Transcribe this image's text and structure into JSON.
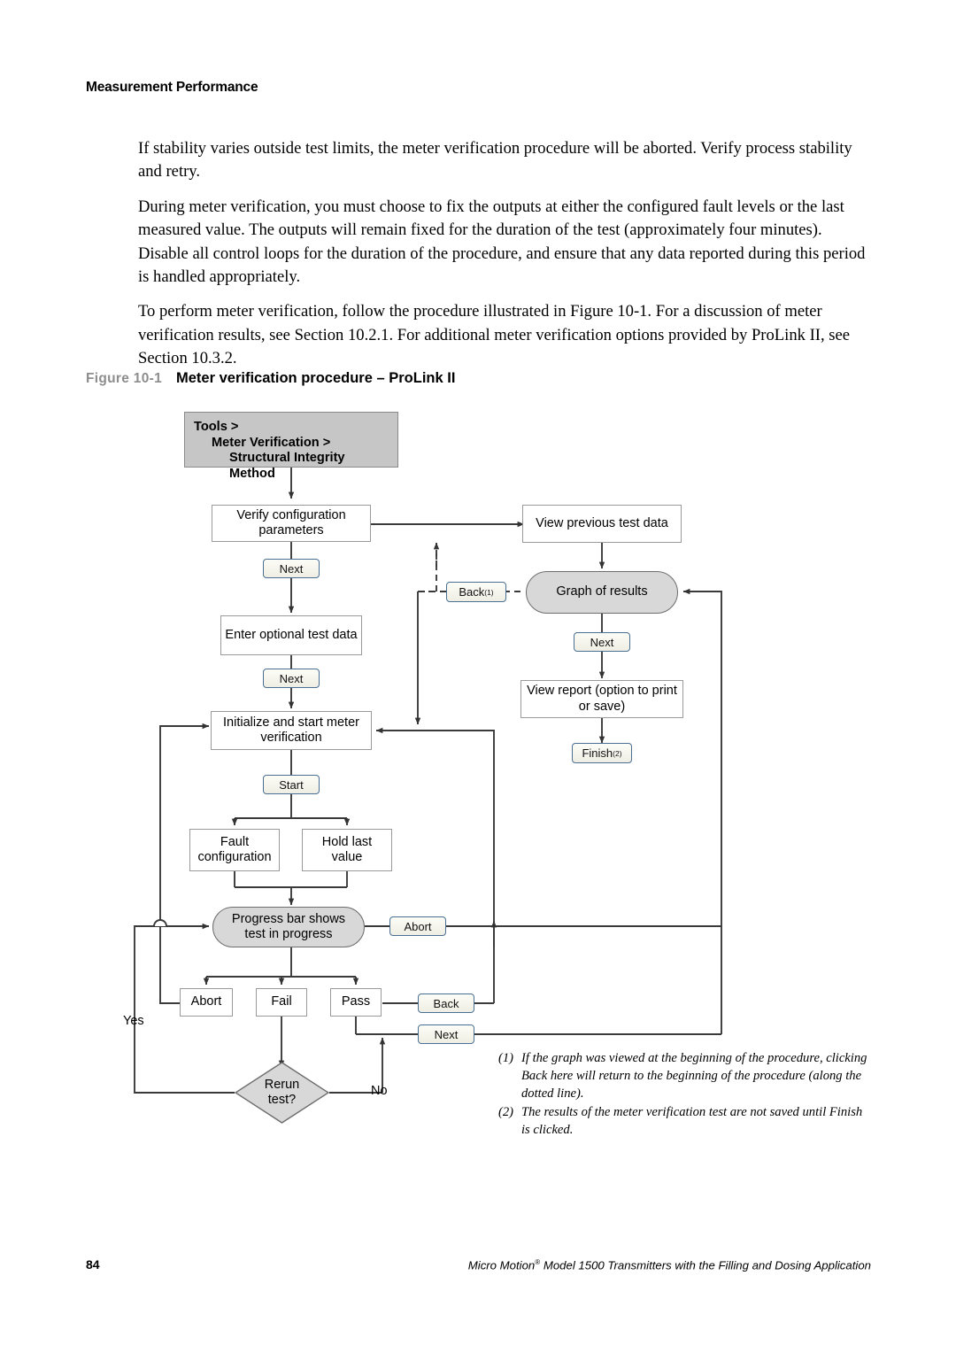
{
  "running_head": "Measurement Performance",
  "paragraphs": [
    "If stability varies outside test limits, the meter verification procedure will be aborted. Verify process stability and retry.",
    "During meter verification, you must choose to fix the outputs at either the configured fault levels or the last measured value. The outputs will remain fixed for the duration of the test (approximately four minutes). Disable all control loops for the duration of the procedure, and ensure that any data reported during this period is handled appropriately.",
    "To perform meter verification, follow the procedure illustrated in Figure 10-1. For a discussion of meter verification results, see Section 10.2.1. For additional meter verification options provided by ProLink II, see Section 10.3.2."
  ],
  "figure": {
    "number": "Figure 10-1",
    "title": "Meter verification procedure – ProLink II"
  },
  "flowchart": {
    "header": {
      "line1": "Tools >",
      "line2": "Meter Verification >",
      "line3": "Structural Integrity Method"
    },
    "nodes": {
      "verify_config": "Verify configuration\nparameters",
      "view_previous": "View previous test data",
      "enter_optional": "Enter optional test data",
      "graph_results": "Graph of results",
      "view_report": "View report (option to print\nor save)",
      "initialize": "Initialize and start meter\nverification",
      "fault_config": "Fault\nconfiguration",
      "hold_last": "Hold last\nvalue",
      "progress": "Progress bar shows\ntest in progress",
      "abort_result": "Abort",
      "fail_result": "Fail",
      "pass_result": "Pass",
      "rerun": "Rerun\ntest?"
    },
    "buttons": {
      "next1": "Next",
      "next2": "Next",
      "start": "Start",
      "abort": "Abort",
      "back_result": "Back",
      "next_result": "Next",
      "back_graph": "Back",
      "back_graph_sup": "(1)",
      "next_graph": "Next",
      "finish": "Finish",
      "finish_sup": "(2)"
    },
    "edge_labels": {
      "yes": "Yes",
      "no": "No"
    },
    "colors": {
      "header_fill": "#c6c6c6",
      "stadium_fill": "#d8d8d8",
      "diamond_fill": "#d8d8d8",
      "button_border": "#4a6f93",
      "box_border": "#9a9a9a",
      "line": "#3a3a3a"
    }
  },
  "footnotes": [
    {
      "mark": "(1)",
      "text": "If the graph was viewed at the beginning of the procedure, clicking Back here will return to the beginning of the procedure (along the dotted line)."
    },
    {
      "mark": "(2)",
      "text": "The results of the meter verification test are not saved until Finish is clicked."
    }
  ],
  "footer": {
    "page_number": "84",
    "title_pre": "Micro Motion",
    "title_sup": "®",
    "title_post": " Model 1500 Transmitters with the Filling and Dosing Application"
  }
}
